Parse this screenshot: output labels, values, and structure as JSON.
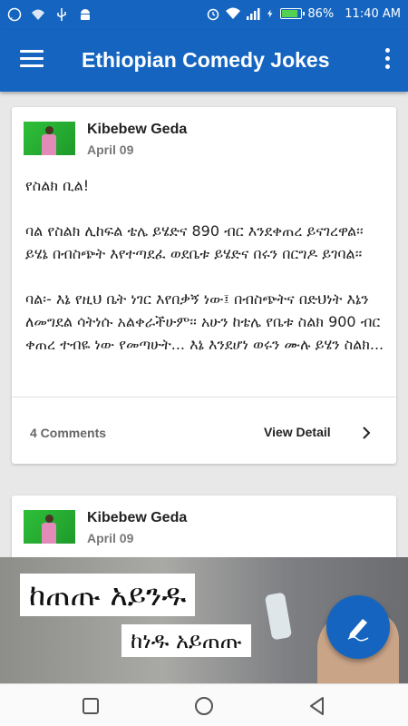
{
  "status_bar": {
    "battery_percent_text": "86%",
    "battery_level": 0.86,
    "time": "11:40 AM",
    "icons": [
      "whatsapp-icon",
      "wifi-icon",
      "usb-icon",
      "android-icon",
      "alarm-icon",
      "wifi-signal-icon",
      "cell-signal-icon",
      "charging-icon",
      "battery-icon"
    ]
  },
  "app_bar": {
    "title": "Ethiopian Comedy Jokes",
    "menu_icon": "hamburger-menu-icon",
    "overflow_icon": "more-vert-icon"
  },
  "posts": [
    {
      "author": "Kibebew Geda",
      "date": "April 09",
      "body": "የስልክ ቢል!\n\nባል የስልክ ሊከፍል ቴሌ ይሄድና 890 ብር እንደቀጠረ ይናገረዋል፡፡ ይሄኔ በብስጭት እየተጣደፈ ወደቤቱ ይሄድና በሩን በርግዶ ይገባል፡፡\n\nባል፡- እኔ የዚህ ቤት ነገር እየበቃኝ ነው፤ በብስጭትና በድህነት እኔን ለመግደል ሳትነሱ አልቀራችሁም፡፡ አሁን ከቴሌ የቤቱ ስልክ 900 ብር ቀጠረ ተብዬ ነው የመጣሁት... እኔ እንደሆነ ወሩን ሙሉ ይሄን ስልክ...",
      "comments": "4 Comments",
      "view_detail": "View Detail"
    },
    {
      "author": "Kibebew Geda",
      "date": "April 09"
    }
  ],
  "image_post": {
    "line1": "ከጠጡ አይንዱ",
    "line2": "ከነዱ አይጠጡ"
  },
  "fab": {
    "icon": "compose-icon"
  },
  "nav_bar": {
    "icons": [
      "recents-square-icon",
      "home-circle-icon",
      "back-triangle-icon"
    ]
  },
  "colors": {
    "primary": "#1565c0",
    "background": "#e8e8e8",
    "battery_fill": "#52d152"
  }
}
